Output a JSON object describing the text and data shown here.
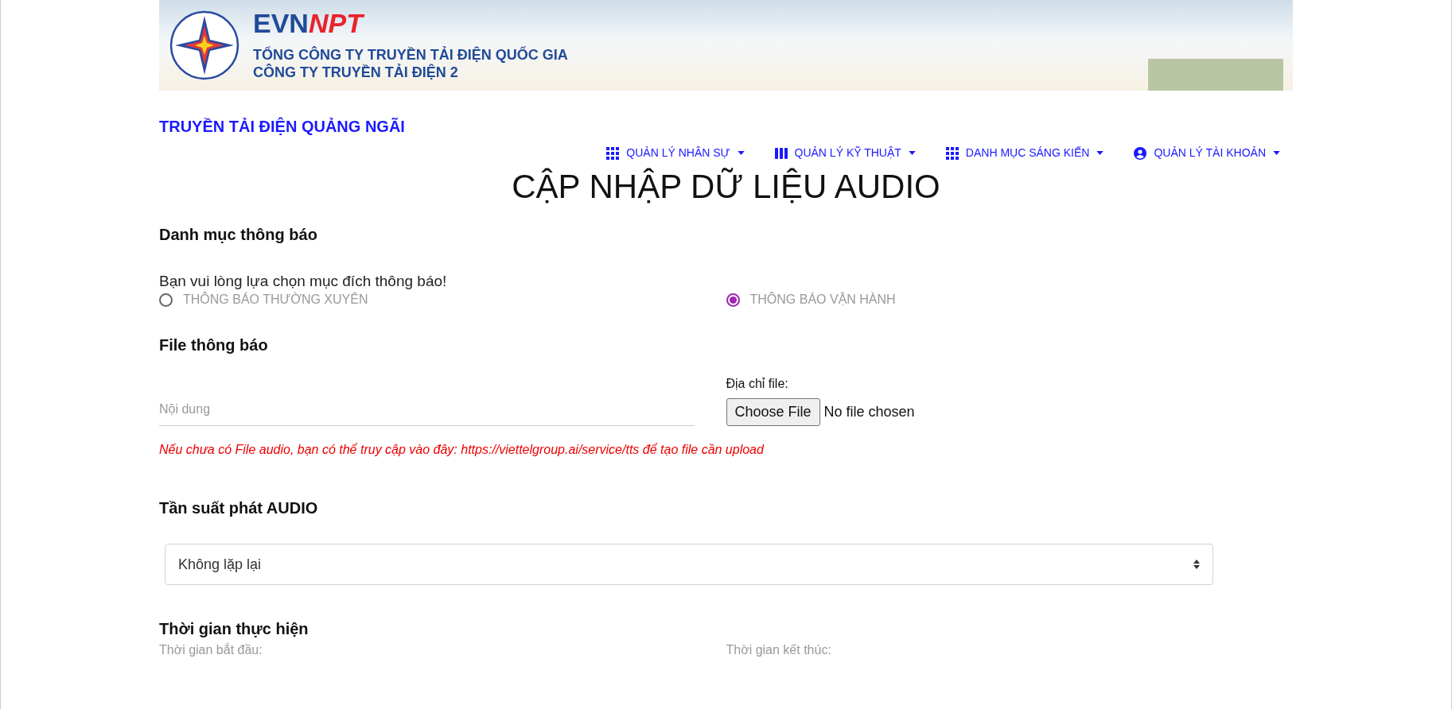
{
  "banner": {
    "logo_left": "EVN",
    "logo_right": "NPT",
    "line_1": "TỔNG CÔNG TY TRUYỀN TẢI ĐIỆN QUỐC GIA",
    "line_2": "CÔNG TY TRUYỀN TẢI ĐIỆN 2"
  },
  "site_title": "TRUYỀN TẢI ĐIỆN QUẢNG NGÃI",
  "nav": [
    {
      "label": "QUẢN LÝ NHÂN SỰ",
      "kind": "grid"
    },
    {
      "label": "QUẢN LÝ KỸ THUẬT",
      "kind": "columns"
    },
    {
      "label": "DANH MỤC SÁNG KIẾN",
      "kind": "grid"
    },
    {
      "label": "QUẢN LÝ TÀI KHOẢN",
      "kind": "account"
    }
  ],
  "page_title": "CẬP NHẬP DỮ LIỆU AUDIO",
  "category": {
    "heading": "Danh mục thông báo",
    "prompt": "Bạn vui lòng lựa chọn mục đích thông báo!",
    "options": [
      {
        "label": "THÔNG BÁO THƯỜNG XUYÊN",
        "selected": false
      },
      {
        "label": "THÔNG BÁO VẬN HÀNH",
        "selected": true
      }
    ]
  },
  "file": {
    "heading": "File thông báo",
    "content_placeholder": "Nội dung",
    "path_label": "Địa chỉ file:",
    "choose_button": "Choose File",
    "file_status": "No file chosen",
    "hint": "Nếu chưa có File audio, bạn có thể truy cập vào đây: https://viettelgroup.ai/service/tts để tạo file cần upload"
  },
  "frequency": {
    "heading": "Tần suất phát AUDIO",
    "value": "Không lặp lại"
  },
  "time": {
    "heading": "Thời gian thực hiện",
    "start_label": "Thời gian bắt đầu:",
    "end_label": "Thời gian kết thúc:"
  }
}
